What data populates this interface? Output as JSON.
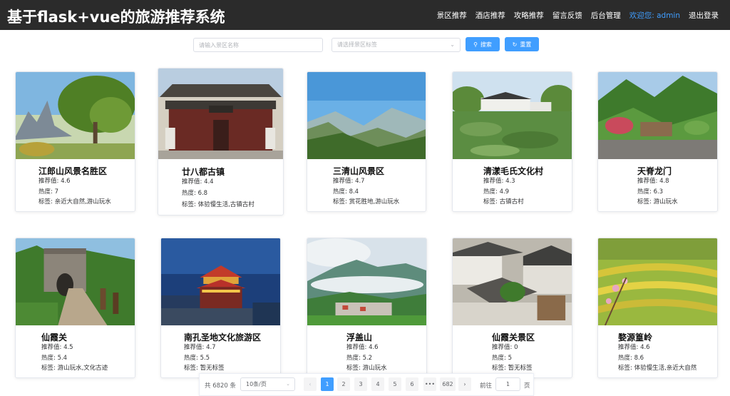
{
  "header": {
    "brand": "基于flask+vue的旅游推荐系统",
    "nav": [
      "景区推荐",
      "酒店推荐",
      "攻略推荐",
      "留言反馈",
      "后台管理"
    ],
    "welcome": "欢迎您: admin",
    "logout": "退出登录"
  },
  "search": {
    "name_placeholder": "请输入景区名称",
    "tag_placeholder": "请选择景区标签",
    "search_label": "搜索",
    "reset_label": "重置"
  },
  "cards": [
    {
      "name": "江郎山风景名胜区",
      "rec": "推荐值: 4.6",
      "hot": "热度: 7",
      "tags": "标签: 亲近大自然,游山玩水"
    },
    {
      "name": "廿八都古镇",
      "rec": "推荐值: 4.4",
      "hot": "热度: 6.8",
      "tags": "标签: 体验慢生活,古镇古村"
    },
    {
      "name": "三清山风景区",
      "rec": "推荐值: 4.7",
      "hot": "热度: 8.4",
      "tags": "标签: 赏花胜地,游山玩水"
    },
    {
      "name": "清漾毛氏文化村",
      "rec": "推荐值: 4.3",
      "hot": "热度: 4.9",
      "tags": "标签: 古镇古村"
    },
    {
      "name": "天脊龙门",
      "rec": "推荐值: 4.8",
      "hot": "热度: 6.3",
      "tags": "标签: 游山玩水"
    },
    {
      "name": "仙霞关",
      "rec": "推荐值: 4.5",
      "hot": "热度: 5.4",
      "tags": "标签: 游山玩水,文化古迹"
    },
    {
      "name": "南孔圣地文化旅游区",
      "rec": "推荐值: 4.7",
      "hot": "热度: 5.5",
      "tags": "标签: 暂无标签"
    },
    {
      "name": "浮盖山",
      "rec": "推荐值: 4.6",
      "hot": "热度: 5.2",
      "tags": "标签: 游山玩水"
    },
    {
      "name": "仙霞关景区",
      "rec": "推荐值: 0",
      "hot": "热度: 5",
      "tags": "标签: 暂无标签"
    },
    {
      "name": "婺源篁岭",
      "rec": "推荐值: 4.6",
      "hot": "热度: 8.6",
      "tags": "标签: 体验慢生活,亲近大自然"
    }
  ],
  "pagination": {
    "total": "共 6820 条",
    "page_size": "10条/页",
    "pages": [
      "1",
      "2",
      "3",
      "4",
      "5",
      "6",
      "•••",
      "682"
    ],
    "goto": "前往",
    "current": "1",
    "unit": "页"
  },
  "icons": {
    "search": "search-icon",
    "reset": "refresh-icon",
    "caret": "chevron-down-icon",
    "prev": "chevron-left-icon",
    "next": "chevron-right-icon"
  },
  "colors": {
    "header_bg": "#2b2b2b",
    "accent": "#409eff",
    "welcome": "#409eff"
  }
}
